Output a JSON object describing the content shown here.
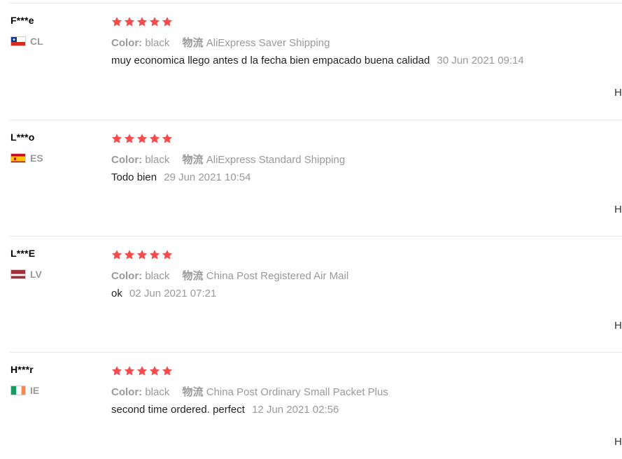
{
  "labels": {
    "color_key": "Color:",
    "shipping_key": "物流",
    "helpful_cut": "H"
  },
  "colors": {
    "star": "#f44c4c",
    "divider": "#e8e8e8",
    "muted": "#999999"
  },
  "reviews": [
    {
      "user": "F***e",
      "country": "CL",
      "flag_icon": "chile-flag-icon",
      "rating": 5,
      "color": "black",
      "shipping": "AliExpress Saver Shipping",
      "text": "muy economica llego antes d la fecha bien empacado buena calidad",
      "date": "30 Jun 2021 09:14"
    },
    {
      "user": "L***o",
      "country": "ES",
      "flag_icon": "spain-flag-icon",
      "rating": 5,
      "color": "black",
      "shipping": "AliExpress Standard Shipping",
      "text": "Todo bien",
      "date": "29 Jun 2021 10:54"
    },
    {
      "user": "L***E",
      "country": "LV",
      "flag_icon": "latvia-flag-icon",
      "rating": 5,
      "color": "black",
      "shipping": "China Post Registered Air Mail",
      "text": "ok",
      "date": "02 Jun 2021 07:21"
    },
    {
      "user": "H***r",
      "country": "IE",
      "flag_icon": "ireland-flag-icon",
      "rating": 5,
      "color": "black",
      "shipping": "China Post Ordinary Small Packet Plus",
      "text": "second time ordered. perfect",
      "date": "12 Jun 2021 02:56"
    }
  ]
}
